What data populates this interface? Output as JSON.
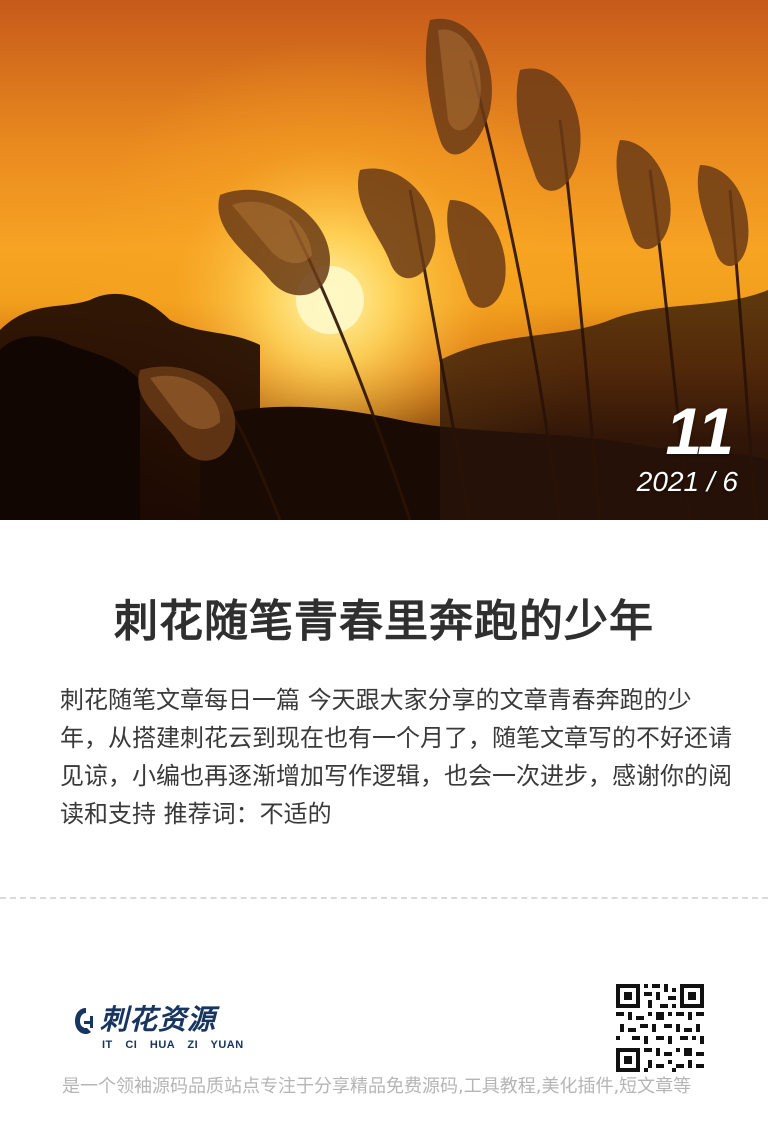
{
  "post": {
    "day": "11",
    "year_month": "2021 / 6",
    "title": "刺花随笔青春里奔跑的少年",
    "excerpt": "刺花随笔文章每日一篇 今天跟大家分享的文章青春奔跑的少年，从搭建刺花云到现在也有一个月了，随笔文章写的不好还请见谅，小编也再逐渐增加写作逻辑，也会一次进步，感谢你的阅读和支持 推荐词：不适的"
  },
  "brand": {
    "logo_text": "刺花资源",
    "logo_sub": "IT CI HUA ZI YUAN",
    "description": "是一个领袖源码品质站点专注于分享精品免费源码,工具教程,美化插件,短文章等",
    "logo_color": "#17355f",
    "qr_icon": "qr-code"
  },
  "colors": {
    "title": "#2f2f2f",
    "body_text": "#3a3a3a",
    "muted_text": "#b5b5b5"
  }
}
